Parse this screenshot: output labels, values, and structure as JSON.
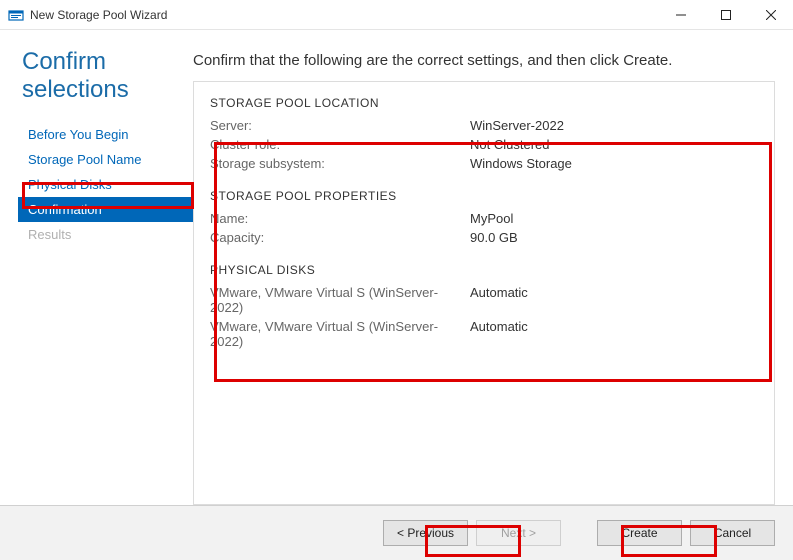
{
  "window": {
    "title": "New Storage Pool Wizard"
  },
  "page": {
    "heading": "Confirm selections",
    "instruction": "Confirm that the following are the correct settings, and then click Create."
  },
  "nav": {
    "beforeYouBegin": "Before You Begin",
    "storagePoolName": "Storage Pool Name",
    "physicalDisks": "Physical Disks",
    "confirmation": "Confirmation",
    "results": "Results"
  },
  "sections": {
    "location": {
      "title": "STORAGE POOL LOCATION",
      "server_label": "Server:",
      "server_value": "WinServer-2022",
      "cluster_label": "Cluster role:",
      "cluster_value": "Not Clustered",
      "subsystem_label": "Storage subsystem:",
      "subsystem_value": "Windows Storage"
    },
    "properties": {
      "title": "STORAGE POOL PROPERTIES",
      "name_label": "Name:",
      "name_value": "MyPool",
      "capacity_label": "Capacity:",
      "capacity_value": "90.0 GB"
    },
    "disks": {
      "title": "PHYSICAL DISKS",
      "rows": [
        {
          "desc": "VMware, VMware Virtual S (WinServer-2022)",
          "alloc": "Automatic"
        },
        {
          "desc": "VMware, VMware Virtual S (WinServer-2022)",
          "alloc": "Automatic"
        }
      ]
    }
  },
  "footer": {
    "previous": "< Previous",
    "next": "Next >",
    "create": "Create",
    "cancel": "Cancel"
  }
}
